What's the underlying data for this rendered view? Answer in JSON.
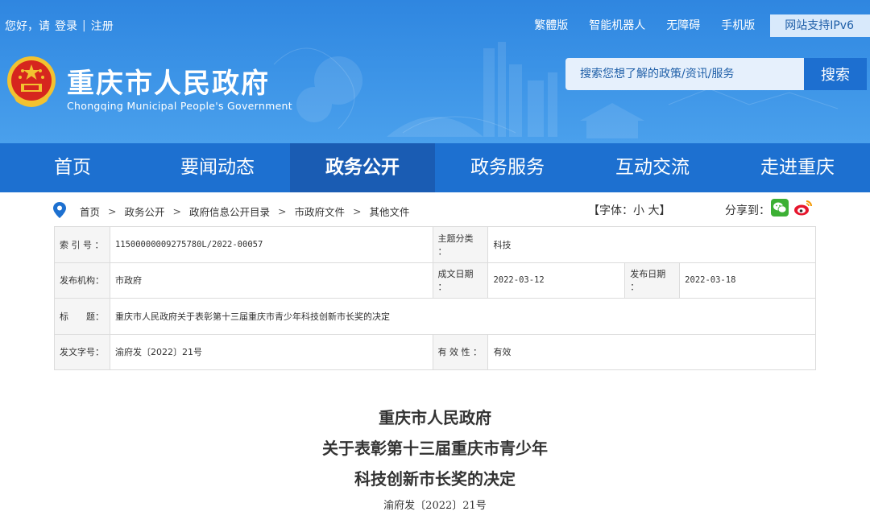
{
  "topbar": {
    "greeting": "您好，请",
    "login": "登录",
    "separator": "|",
    "register": "注册",
    "links": [
      "繁體版",
      "智能机器人",
      "无障碍",
      "手机版"
    ],
    "ipv6": "网站支持IPv6"
  },
  "site": {
    "title": "重庆市人民政府",
    "subtitle": "Chongqing Municipal People's Government"
  },
  "search": {
    "placeholder": "搜索您想了解的政策/资讯/服务",
    "button": "搜索"
  },
  "nav": {
    "items": [
      "首页",
      "要闻动态",
      "政务公开",
      "政务服务",
      "互动交流",
      "走进重庆"
    ],
    "active_index": 2
  },
  "breadcrumb": {
    "items": [
      "首页",
      "政务公开",
      "政府信息公开目录",
      "市政府文件",
      "其他文件"
    ],
    "arrow": ">"
  },
  "font_size": {
    "prefix": "【字体：",
    "small": "小",
    "large": "大",
    "suffix": "】"
  },
  "share": {
    "label": "分享到："
  },
  "info": {
    "index_label": "索 引 号 ：",
    "index_value": "11500000009275780L/2022-00057",
    "topic_label": "主题分类 ：",
    "topic_value": "科技",
    "org_label": "发布机构：",
    "org_value": "市政府",
    "created_label": "成文日期 ：",
    "created_value": "2022-03-12",
    "published_label": "发布日期 ：",
    "published_value": "2022-03-18",
    "title_label": "标　　题：",
    "title_value": "重庆市人民政府关于表彰第十三届重庆市青少年科技创新市长奖的决定",
    "docno_label": "发文字号：",
    "docno_value": "渝府发〔2022〕21号",
    "validity_label": "有 效 性 ：",
    "validity_value": "有效"
  },
  "document": {
    "line1": "重庆市人民政府",
    "line2": "关于表彰第十三届重庆市青少年",
    "line3": "科技创新市长奖的决定",
    "docno": "渝府发〔2022〕21号"
  },
  "colors": {
    "header_blue": "#3a92e6",
    "nav_blue": "#1d70d0",
    "nav_active": "#1a5cb3",
    "search_button": "#1d6fd0"
  }
}
